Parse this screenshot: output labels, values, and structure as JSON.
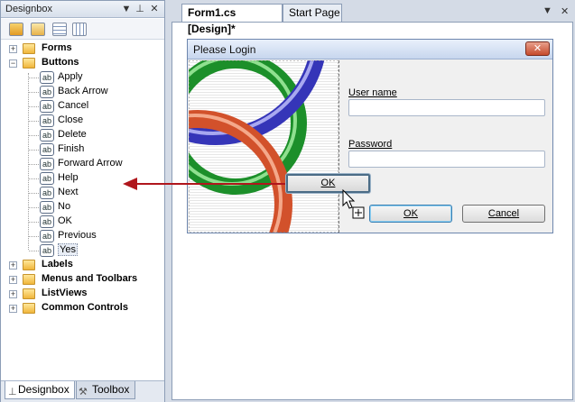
{
  "panel": {
    "title": "Designbox",
    "pin_glyph": "▼",
    "autohide_glyph": "⊥",
    "close_glyph": "✕",
    "toolbar": [
      {
        "name": "add-item-icon"
      },
      {
        "name": "import-icon"
      },
      {
        "name": "list-view-icon"
      },
      {
        "name": "details-view-icon"
      }
    ],
    "tree": {
      "forms": "Forms",
      "buttons": "Buttons",
      "button_items": [
        "Apply",
        "Back Arrow",
        "Cancel",
        "Close",
        "Delete",
        "Finish",
        "Forward Arrow",
        "Help",
        "Next",
        "No",
        "OK",
        "Previous",
        "Yes"
      ],
      "selected_item": "Yes",
      "item_icon_text": "ab",
      "labels": "Labels",
      "menus": "Menus and Toolbars",
      "listviews": "ListViews",
      "common": "Common Controls"
    },
    "tabs": {
      "designbox": "Designbox",
      "toolbox": "Toolbox"
    }
  },
  "document": {
    "active_tab": "Form1.cs [Design]*",
    "inactive_tab": "Start Page",
    "dropdown_glyph": "▼",
    "close_glyph": "✕"
  },
  "form": {
    "caption": "Please Login",
    "close_glyph": "✕",
    "username_label": "User name",
    "username_value": "",
    "password_label": "Password",
    "password_value": "",
    "ok_label": "OK",
    "cancel_label": "Cancel"
  },
  "drag": {
    "preview_label": "OK",
    "arrow_color": "#b0161c"
  }
}
